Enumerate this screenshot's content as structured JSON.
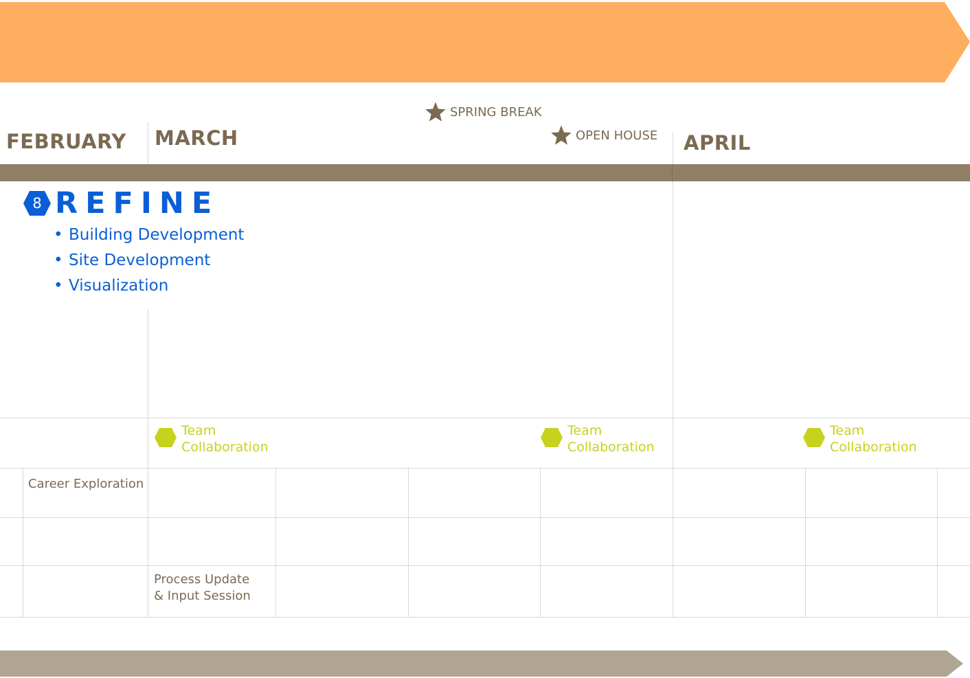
{
  "colors": {
    "top_band": "#FFAD5E",
    "bottom_band": "#B0A592",
    "brown_bar": "#8F7F67",
    "month_text": "#7B6A52",
    "refine_blue": "#0B5FD6",
    "team_green": "#C7D21F"
  },
  "months": {
    "february": "FEBRUARY",
    "march": "MARCH",
    "april": "APRIL"
  },
  "events": {
    "spring_break": {
      "label": "SPRING BREAK",
      "icon": "star-icon"
    },
    "open_house": {
      "label": "OPEN HOUSE",
      "icon": "star-icon"
    }
  },
  "refine": {
    "badge_number": "8",
    "title": "REFINE",
    "items": [
      {
        "bullet": "•",
        "label": "Building Development"
      },
      {
        "bullet": "•",
        "label": "Site Development"
      },
      {
        "bullet": "•",
        "label": "Visualization"
      }
    ]
  },
  "team_collaboration": [
    {
      "line1": "Team",
      "line2": "Collaboration",
      "icon": "hexagon-icon"
    },
    {
      "line1": "Team",
      "line2": "Collaboration",
      "icon": "hexagon-icon"
    },
    {
      "line1": "Team",
      "line2": "Collaboration",
      "icon": "hexagon-icon"
    }
  ],
  "rows": {
    "career_exploration": "Career Exploration",
    "process_update": {
      "line1": "Process Update",
      "line2": "& Input Session"
    }
  }
}
